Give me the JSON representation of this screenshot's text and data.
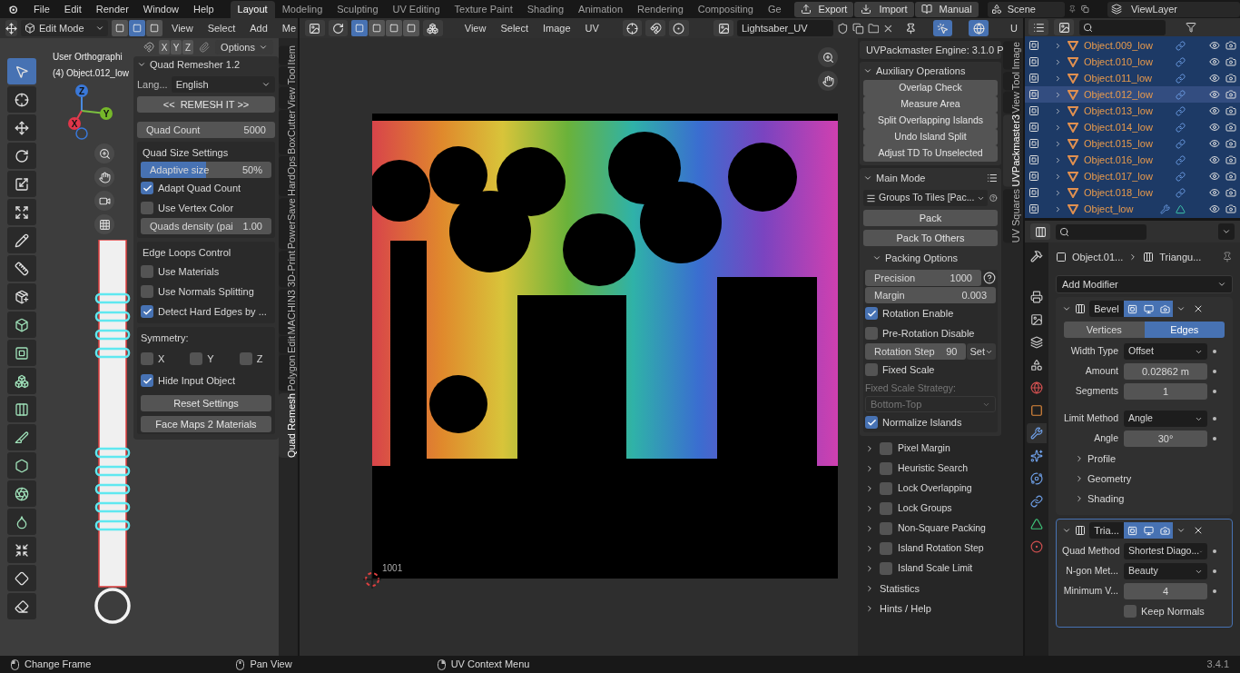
{
  "topbar": {
    "menus": [
      "File",
      "Edit",
      "Render",
      "Window",
      "Help"
    ],
    "workspaces": [
      {
        "label": "Layout",
        "selected": true
      },
      {
        "label": "Modeling",
        "selected": false
      },
      {
        "label": "Sculpting",
        "selected": false
      },
      {
        "label": "UV Editing",
        "selected": false
      },
      {
        "label": "Texture Paint",
        "selected": false
      },
      {
        "label": "Shading",
        "selected": false
      },
      {
        "label": "Animation",
        "selected": false
      },
      {
        "label": "Rendering",
        "selected": false
      },
      {
        "label": "Compositing",
        "selected": false
      },
      {
        "label": "Ge",
        "selected": false
      }
    ],
    "buttons": [
      {
        "kind": "export",
        "label": "Export"
      },
      {
        "kind": "import",
        "label": "Import"
      },
      {
        "kind": "manual",
        "label": "Manual"
      }
    ],
    "scene": "Scene",
    "view_layer": "ViewLayer"
  },
  "viewport": {
    "mode": "Edit Mode",
    "select_modes": [
      {
        "selected": false
      },
      {
        "selected": true
      },
      {
        "selected": false
      }
    ],
    "menus": [
      "View",
      "Select",
      "Add",
      "Me"
    ],
    "axes": [
      "X",
      "Y",
      "Z"
    ],
    "options": "Options",
    "overlay_lines": [
      "User Orthographi",
      "(4) Object.012_low"
    ],
    "gizmo": [
      "Z",
      "X",
      "Y"
    ],
    "tools": [
      {
        "kind": "select",
        "selected": true
      },
      {
        "kind": "cursor",
        "selected": false
      },
      {
        "kind": "move",
        "selected": false
      },
      {
        "kind": "rotate",
        "selected": false
      },
      {
        "kind": "scale",
        "selected": false
      },
      {
        "kind": "transform",
        "selected": false
      },
      {
        "kind": "annotate",
        "selected": false
      },
      {
        "kind": "measure",
        "selected": false
      },
      {
        "kind": "add_cube",
        "selected": false
      },
      {
        "kind": "extrude",
        "selected": false
      },
      {
        "kind": "inset",
        "selected": false
      },
      {
        "kind": "bevel",
        "selected": false
      },
      {
        "kind": "loop_cut",
        "selected": false
      },
      {
        "kind": "knife",
        "selected": false
      },
      {
        "kind": "poly_build",
        "selected": false
      },
      {
        "kind": "spin",
        "selected": false
      },
      {
        "kind": "smooth",
        "selected": false
      },
      {
        "kind": "shrink",
        "selected": false
      },
      {
        "kind": "shear",
        "selected": false
      },
      {
        "kind": "rip",
        "selected": false
      }
    ],
    "tabs": [
      {
        "label": "Item",
        "selected": false
      },
      {
        "label": "Tool",
        "selected": false
      },
      {
        "label": "View",
        "selected": false
      },
      {
        "label": "BoxCutter",
        "selected": false
      },
      {
        "label": "HardOps",
        "selected": false
      },
      {
        "label": "PowerSave",
        "selected": false
      },
      {
        "label": "3D-Print",
        "selected": false
      },
      {
        "label": "MACHIN3",
        "selected": false
      },
      {
        "label": "Edit",
        "selected": false
      },
      {
        "label": "Polygon",
        "selected": false
      },
      {
        "label": "Quad Remesh",
        "selected": true
      }
    ]
  },
  "quad_remesher": {
    "title": "Quad Remesher 1.2",
    "language_label": "Lang...",
    "language": "English",
    "remesh_button": "<<  REMESH IT >>",
    "quad_count": {
      "label": "Quad Count",
      "value": "5000"
    },
    "size_group": {
      "title": "Quad Size Settings",
      "adaptive": {
        "label": "Adaptive size",
        "value": "50%",
        "level": 0.5
      },
      "checks": [
        {
          "label": "Adapt Quad Count",
          "checked": true
        },
        {
          "label": "Use Vertex Color",
          "checked": false
        }
      ],
      "density": {
        "label": "Quads density (pai",
        "value": "1.00"
      }
    },
    "edge_group": {
      "title": "Edge Loops Control",
      "checks": [
        {
          "label": "Use Materials",
          "checked": false
        },
        {
          "label": "Use Normals Splitting",
          "checked": false
        },
        {
          "label": "Detect Hard Edges by ...",
          "checked": true
        }
      ]
    },
    "symmetry": {
      "title": "Symmetry:",
      "axes": [
        {
          "label": "X",
          "checked": false
        },
        {
          "label": "Y",
          "checked": false
        },
        {
          "label": "Z",
          "checked": false
        }
      ],
      "checks": [
        {
          "label": "Hide Input Object",
          "checked": true
        }
      ],
      "buttons": [
        "Reset Settings",
        "Face Maps 2 Materials"
      ]
    }
  },
  "uv_editor": {
    "select_modes": [
      {
        "selected": true
      },
      {
        "selected": false
      },
      {
        "selected": false
      },
      {
        "selected": false
      }
    ],
    "menus": [
      "View",
      "Select",
      "Image",
      "UV"
    ],
    "image_name": "Lightsaber_UV",
    "header_cut": "U",
    "tile_label": "1001",
    "tabs": [
      {
        "label": "Image",
        "selected": false
      },
      {
        "label": "Tool",
        "selected": false
      },
      {
        "label": "View",
        "selected": false
      },
      {
        "label": "UVPackmaster3",
        "selected": true
      },
      {
        "label": "UV Squares",
        "selected": false
      }
    ]
  },
  "uvpackmaster": {
    "engine": "UVPackmaster Engine: 3.1.0 P",
    "aux": {
      "title": "Auxiliary Operations",
      "buttons": [
        "Overlap Check",
        "Measure Area",
        "Split Overlapping Islands",
        "Undo Island Split",
        "Adjust TD To Unselected"
      ]
    },
    "main_mode": {
      "title": "Main Mode",
      "mode": "Groups To Tiles [Pac...",
      "buttons": [
        "Pack",
        "Pack To Others"
      ]
    },
    "packing_options": {
      "title": "Packing Options",
      "precision": {
        "label": "Precision",
        "value": "1000"
      },
      "margin": {
        "label": "Margin",
        "value": "0.003"
      },
      "rotation_enable": {
        "label": "Rotation Enable",
        "checked": true
      },
      "pre_rotation": {
        "label": "Pre-Rotation Disable",
        "checked": false
      },
      "rotation_step": {
        "label": "Rotation Step",
        "value": "90",
        "set": "Set"
      },
      "fixed_scale": {
        "label": "Fixed Scale",
        "checked": false
      },
      "strategy_label": "Fixed Scale Strategy:",
      "strategy": "Bottom-Top",
      "normalize": {
        "label": "Normalize Islands",
        "checked": true
      }
    },
    "subpanels": [
      {
        "label": "Pixel Margin",
        "checked": false
      },
      {
        "label": "Heuristic Search",
        "checked": false
      },
      {
        "label": "Lock Overlapping",
        "checked": false
      },
      {
        "label": "Lock Groups",
        "checked": false
      },
      {
        "label": "Non-Square Packing",
        "checked": false
      },
      {
        "label": "Island Rotation Step",
        "checked": false
      },
      {
        "label": "Island Scale Limit",
        "checked": false
      }
    ],
    "sections": [
      "Statistics",
      "Hints / Help"
    ]
  },
  "outliner": {
    "rows": [
      {
        "name": "Object.009_low",
        "selected": false,
        "modifier": false
      },
      {
        "name": "Object.010_low",
        "selected": false,
        "modifier": false
      },
      {
        "name": "Object.011_low",
        "selected": false,
        "modifier": false
      },
      {
        "name": "Object.012_low",
        "selected": true,
        "modifier": false
      },
      {
        "name": "Object.013_low",
        "selected": false,
        "modifier": false
      },
      {
        "name": "Object.014_low",
        "selected": false,
        "modifier": false
      },
      {
        "name": "Object.015_low",
        "selected": false,
        "modifier": false
      },
      {
        "name": "Object.016_low",
        "selected": false,
        "modifier": false
      },
      {
        "name": "Object.017_low",
        "selected": false,
        "modifier": false
      },
      {
        "name": "Object.018_low",
        "selected": false,
        "modifier": false
      },
      {
        "name": "Object_low",
        "selected": false,
        "modifier": true
      }
    ]
  },
  "properties": {
    "tabs": [
      {
        "kind": "tool",
        "selected": false
      },
      {
        "kind": "render",
        "selected": false
      },
      {
        "kind": "output",
        "selected": false
      },
      {
        "kind": "view_layer",
        "selected": false
      },
      {
        "kind": "scene",
        "selected": false
      },
      {
        "kind": "world",
        "selected": false
      },
      {
        "kind": "object",
        "selected": false
      },
      {
        "kind": "modifier",
        "selected": true
      },
      {
        "kind": "particles",
        "selected": false
      },
      {
        "kind": "physics",
        "selected": false
      },
      {
        "kind": "constraints",
        "selected": false
      },
      {
        "kind": "data",
        "selected": false
      },
      {
        "kind": "material",
        "selected": false
      }
    ],
    "breadcrumb": [
      "Object.01...",
      "Triangu..."
    ],
    "add_modifier": "Add Modifier",
    "modifiers": [
      {
        "name": "Bevel",
        "active": false,
        "tabs": [
          {
            "label": "Vertices",
            "selected": false
          },
          {
            "label": "Edges",
            "selected": true
          }
        ],
        "fields": [
          {
            "label": "Width Type",
            "value": "Offset",
            "kind": "dropdown"
          },
          {
            "label": "Amount",
            "value": "0.02862 m",
            "kind": "number"
          },
          {
            "label": "Segments",
            "value": "1",
            "kind": "number"
          },
          {
            "label": "Limit Method",
            "value": "Angle",
            "kind": "dropdown"
          },
          {
            "label": "Angle",
            "value": "30°",
            "kind": "number"
          }
        ],
        "sections": [
          "Profile",
          "Geometry",
          "Shading"
        ]
      },
      {
        "name": "Tria...",
        "active": true,
        "fields": [
          {
            "label": "Quad Method",
            "value": "Shortest Diago...",
            "kind": "dropdown"
          },
          {
            "label": "N-gon Met...",
            "value": "Beauty",
            "kind": "dropdown"
          },
          {
            "label": "Minimum V...",
            "value": "4",
            "kind": "number"
          }
        ],
        "checks": [
          {
            "label": "Keep Normals",
            "checked": false
          }
        ]
      }
    ]
  },
  "status_bar": {
    "hints": [
      {
        "kind": "mouse_left",
        "label": "Change Frame"
      },
      {
        "kind": "mouse_middle",
        "label": "Pan View"
      },
      {
        "kind": "mouse_right",
        "label": "UV Context Menu"
      }
    ],
    "version": "3.4.1"
  }
}
